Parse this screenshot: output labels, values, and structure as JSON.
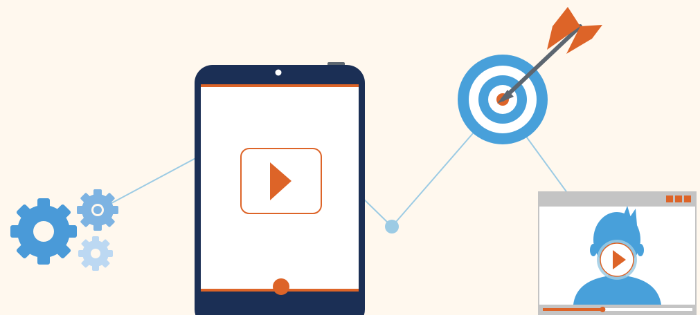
{
  "colors": {
    "background": "#fff8ee",
    "connector": "#9ccbe4",
    "tablet_body": "#1b2f55",
    "tablet_screen": "#ffffff",
    "accent_orange": "#dd6428",
    "gear_primary": "#4a9ad8",
    "gear_secondary": "#7db3e2",
    "gear_light": "#bcd8f2",
    "target_blue": "#48a0da",
    "dart_shaft": "#5c6670",
    "window_chrome": "#c4c4c4",
    "person_blue": "#48a0da"
  },
  "icons": {
    "gears": "gears-icon",
    "tablet": "tablet-icon",
    "play": "play-icon",
    "target": "target-icon",
    "dart": "dart-icon",
    "connector_node": "node-dot-icon",
    "video_window": "video-window-icon",
    "person": "person-icon"
  },
  "video_player": {
    "progress_fraction": 0.4
  }
}
